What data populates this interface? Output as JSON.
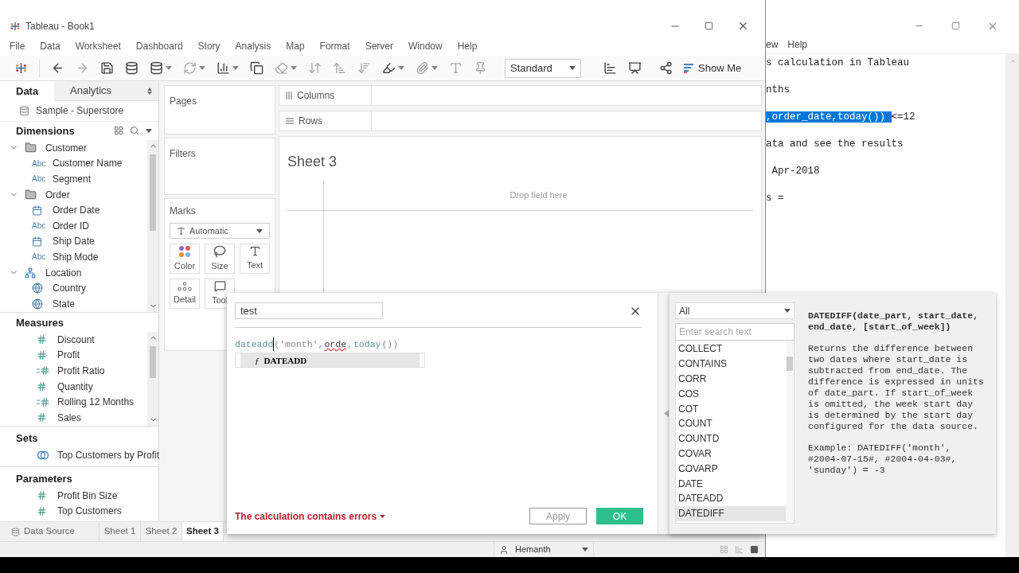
{
  "window": {
    "title": "Tableau - Book1"
  },
  "menu": [
    "File",
    "Data",
    "Worksheet",
    "Dashboard",
    "Story",
    "Analysis",
    "Map",
    "Format",
    "Server",
    "Window",
    "Help"
  ],
  "toolbar": {
    "fit_select": "Standard",
    "show_me": "Show Me"
  },
  "data_pane": {
    "tabs": [
      {
        "label": "Data",
        "selected": true
      },
      {
        "label": "Analytics",
        "selected": false
      }
    ],
    "data_source": "Sample - Superstore",
    "dimensions": {
      "title": "Dimensions",
      "items": [
        {
          "label": "Customer",
          "kind": "folder",
          "expanded": true,
          "children": [
            {
              "label": "Customer Name",
              "kind": "string",
              "badge": "Abc"
            },
            {
              "label": "Segment",
              "kind": "string",
              "badge": "Abc"
            }
          ]
        },
        {
          "label": "Order",
          "kind": "folder",
          "expanded": true,
          "children": [
            {
              "label": "Order Date",
              "kind": "date"
            },
            {
              "label": "Order ID",
              "kind": "string",
              "badge": "Abc"
            },
            {
              "label": "Ship Date",
              "kind": "date"
            },
            {
              "label": "Ship Mode",
              "kind": "string",
              "badge": "Abc"
            }
          ]
        },
        {
          "label": "Location",
          "kind": "hierarchy",
          "expanded": true,
          "children": [
            {
              "label": "Country",
              "kind": "geo"
            },
            {
              "label": "State",
              "kind": "geo"
            }
          ]
        }
      ]
    },
    "measures": {
      "title": "Measures",
      "items": [
        {
          "label": "Discount",
          "kind": "number"
        },
        {
          "label": "Profit",
          "kind": "number"
        },
        {
          "label": "Profit Ratio",
          "kind": "calc"
        },
        {
          "label": "Quantity",
          "kind": "number"
        },
        {
          "label": "Rolling 12 Months",
          "kind": "calc"
        },
        {
          "label": "Sales",
          "kind": "number"
        }
      ]
    },
    "sets": {
      "title": "Sets",
      "items": [
        {
          "label": "Top Customers by Profit",
          "kind": "set"
        }
      ]
    },
    "parameters": {
      "title": "Parameters",
      "items": [
        {
          "label": "Profit Bin Size",
          "kind": "number"
        },
        {
          "label": "Top Customers",
          "kind": "number"
        }
      ]
    }
  },
  "shelves": {
    "pages": "Pages",
    "filters": "Filters",
    "marks": {
      "title": "Marks",
      "type": "Automatic",
      "cards": [
        {
          "label": "Color",
          "kind": "color"
        },
        {
          "label": "Size",
          "kind": "size"
        },
        {
          "label": "Text",
          "kind": "text"
        },
        {
          "label": "Detail",
          "kind": "detail"
        },
        {
          "label": "Tool",
          "kind": "tooltip"
        }
      ]
    }
  },
  "view": {
    "columns": "Columns",
    "rows": "Rows",
    "sheet_title": "Sheet 3",
    "drop_hint": "Drop field here"
  },
  "sheet_tabs": [
    {
      "label": "Data Source",
      "kind": "source",
      "selected": false
    },
    {
      "label": "Sheet 1",
      "kind": "sheet",
      "selected": false
    },
    {
      "label": "Sheet 2",
      "kind": "sheet",
      "selected": false
    },
    {
      "label": "Sheet 3",
      "kind": "sheet",
      "selected": true
    }
  ],
  "status_bar": {
    "user": "Hemanth"
  },
  "calc_dialog": {
    "name": "test",
    "formula": [
      {
        "text": "dateadd",
        "kind": "function",
        "cursor": true
      },
      {
        "text": "('month',",
        "kind": "plain",
        "cursor": false
      },
      {
        "text": "orde",
        "kind": "error",
        "cursor": false
      },
      {
        "text": ",",
        "kind": "plain",
        "cursor": false
      },
      {
        "text": "today",
        "kind": "function",
        "cursor": false
      },
      {
        "text": "())",
        "kind": "plain",
        "cursor": false
      }
    ],
    "autocomplete": [
      {
        "icon": "ƒ",
        "label": "DATEADD",
        "selected": true
      }
    ],
    "error": "The calculation contains errors",
    "buttons": [
      {
        "label": "Apply",
        "kind": "secondary"
      },
      {
        "label": "OK",
        "kind": "primary"
      }
    ]
  },
  "function_panel": {
    "category": "All",
    "search_placeholder": "Enter search text",
    "functions": [
      {
        "label": "COLLECT",
        "selected": false
      },
      {
        "label": "CONTAINS",
        "selected": false
      },
      {
        "label": "CORR",
        "selected": false
      },
      {
        "label": "COS",
        "selected": false
      },
      {
        "label": "COT",
        "selected": false
      },
      {
        "label": "COUNT",
        "selected": false
      },
      {
        "label": "COUNTD",
        "selected": false
      },
      {
        "label": "COVAR",
        "selected": false
      },
      {
        "label": "COVARP",
        "selected": false
      },
      {
        "label": "DATE",
        "selected": false
      },
      {
        "label": "DATEADD",
        "selected": false
      },
      {
        "label": "DATEDIFF",
        "selected": true
      }
    ],
    "signature": "DATEDIFF(date_part, start_date, end_date, [start_of_week])",
    "description": "Returns the difference between two dates where start_date is subtracted from end_date. The difference is expressed in units of date_part. If start_of_week is omitted, the week start day is determined by the start day configured for the data source.",
    "example": "Example: DATEDIFF('month', #2004-07-15#, #2004-04-03#, 'sunday') = -3"
  },
  "notepad": {
    "menu": [
      "ew",
      "Help"
    ],
    "lines": [
      [
        {
          "text": "s calculation in Tableau",
          "selected": false
        }
      ],
      [
        {
          "text": "nths",
          "selected": false
        }
      ],
      [
        {
          "text": ",order_date,today()) ",
          "selected": true
        },
        {
          "text": "<=12",
          "selected": false
        }
      ],
      [
        {
          "text": "ata and see the results",
          "selected": false
        }
      ],
      [
        {
          "text": " Apr-2018",
          "selected": false
        }
      ],
      [
        {
          "text": "s =",
          "selected": false
        }
      ]
    ]
  }
}
